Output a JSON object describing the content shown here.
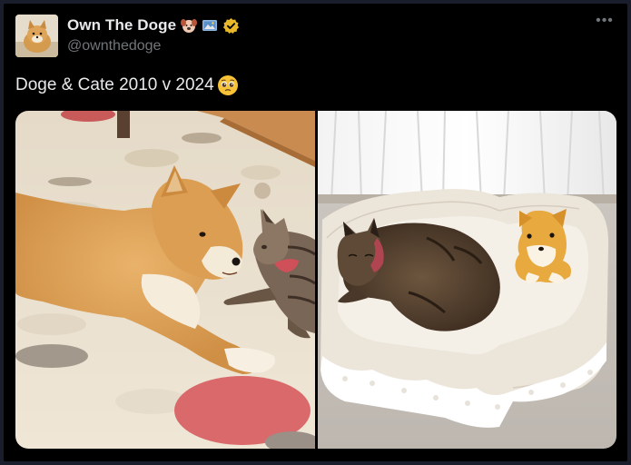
{
  "author": {
    "display_name": "Own The Doge",
    "handle": "@ownthedoge",
    "avatar_icon": "shiba-avatar-icon",
    "badges": [
      "dog-face-icon",
      "picture-frame-icon",
      "verified-badge-icon"
    ]
  },
  "tweet": {
    "text": "Doge & Cate 2010 v 2024",
    "trailing_emoji": "pleading-face-icon"
  },
  "media": {
    "images": [
      {
        "name": "doge-and-cat-2010-photo"
      },
      {
        "name": "cat-and-plush-doge-2024-photo"
      }
    ]
  },
  "actions": {
    "more_label": "•••"
  },
  "colors": {
    "background": "#000000",
    "text_primary": "#e7e9ea",
    "text_secondary": "#71767b",
    "verified_gold": "#e8b829"
  }
}
